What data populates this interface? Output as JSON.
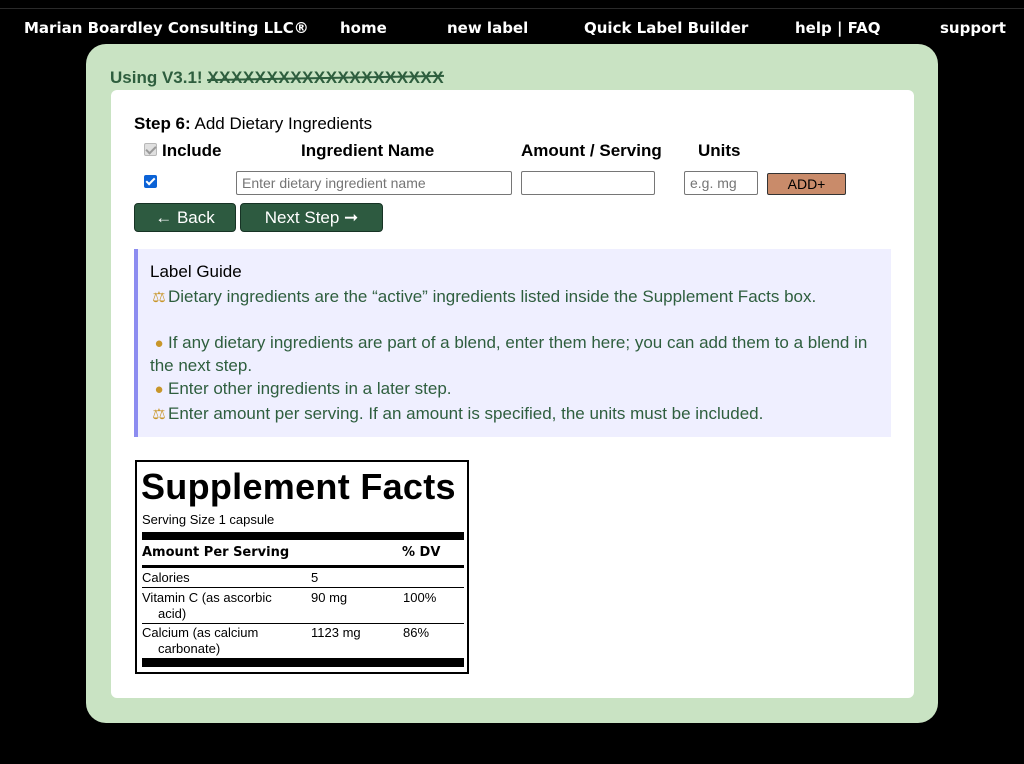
{
  "nav": {
    "brand": "Marian Boardley Consulting LLC®",
    "items": [
      "home",
      "new label",
      "Quick Label Builder",
      "help | FAQ",
      "support"
    ]
  },
  "version_banner": {
    "prefix": "Using V3.1!",
    "masked_text": "XXXXXXXXXXXXXXXXXXXX"
  },
  "step": {
    "label": "Step 6:",
    "title": "Add Dietary Ingredients"
  },
  "table_headers": {
    "include": "Include",
    "name": "Ingredient Name",
    "amount": "Amount / Serving",
    "units": "Units"
  },
  "inputs": {
    "include_checked": true,
    "name_placeholder": "Enter dietary ingredient name",
    "name_value": "",
    "amount_value": "",
    "units_placeholder": "e.g. mg",
    "units_value": ""
  },
  "buttons": {
    "add": "ADD+",
    "back": "← Back",
    "next": "Next Step ➞"
  },
  "guide": {
    "title": "Label Guide",
    "items": [
      {
        "icon": "scale-icon",
        "text": "Dietary ingredients are the “active” ingredients listed inside the Supplement Facts box."
      },
      {
        "icon": "lightbulb-icon",
        "text": "If any dietary ingredients are part of a blend, enter them here; you can add them to a blend in the next step."
      },
      {
        "icon": "lightbulb-icon",
        "text": "Enter other ingredients in a later step."
      },
      {
        "icon": "scale-icon",
        "text": "Enter amount per serving. If an amount is specified, the units must be included."
      }
    ]
  },
  "supplement_facts": {
    "title": "Supplement Facts",
    "serving_size": "Serving Size 1 capsule",
    "header_amount": "Amount Per Serving",
    "header_dv": "% DV",
    "rows": [
      {
        "name": "Calories",
        "amount": "5",
        "dv": ""
      },
      {
        "name": "Vitamin C (as ascorbic acid)",
        "amount": "90 mg",
        "dv": "100%"
      },
      {
        "name": "Calcium (as calcium carbonate)",
        "amount": "1123 mg",
        "dv": "86%"
      }
    ]
  },
  "colors": {
    "background": "#000000",
    "panel": "#c9e3c3",
    "button_dark_green": "#2d5a40",
    "add_button": "#c98b6a",
    "guide_bg": "#efefff",
    "guide_border": "#8c8cf0",
    "guide_text": "#2e5e3e"
  }
}
